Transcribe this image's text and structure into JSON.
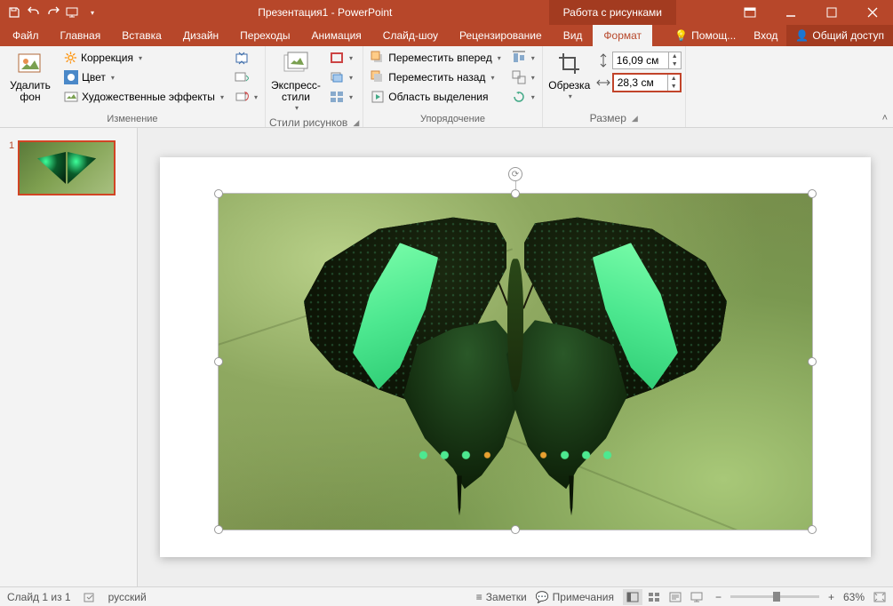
{
  "titlebar": {
    "title": "Презентация1 - PowerPoint",
    "tool_tab": "Работа с рисунками"
  },
  "tabs": {
    "file": "Файл",
    "home": "Главная",
    "insert": "Вставка",
    "design": "Дизайн",
    "transitions": "Переходы",
    "animations": "Анимация",
    "slideshow": "Слайд-шоу",
    "review": "Рецензирование",
    "view": "Вид",
    "format": "Формат"
  },
  "help": {
    "tell_me": "Помощ...",
    "sign_in": "Вход",
    "share": "Общий доступ"
  },
  "ribbon": {
    "remove_bg": "Удалить фон",
    "corrections": "Коррекция",
    "color": "Цвет",
    "artistic": "Художественные эффекты",
    "group_change": "Изменение",
    "styles": "Экспресс-стили",
    "group_styles": "Стили рисунков",
    "bring_forward": "Переместить вперед",
    "send_backward": "Переместить назад",
    "selection_pane": "Область выделения",
    "group_arrange": "Упорядочение",
    "crop": "Обрезка",
    "height_value": "16,09 см",
    "width_value": "28,3 см",
    "group_size": "Размер"
  },
  "thumbs": {
    "n1": "1"
  },
  "status": {
    "slide_of": "Слайд 1 из 1",
    "lang": "русский",
    "notes": "Заметки",
    "comments": "Примечания",
    "zoom": "63%"
  }
}
